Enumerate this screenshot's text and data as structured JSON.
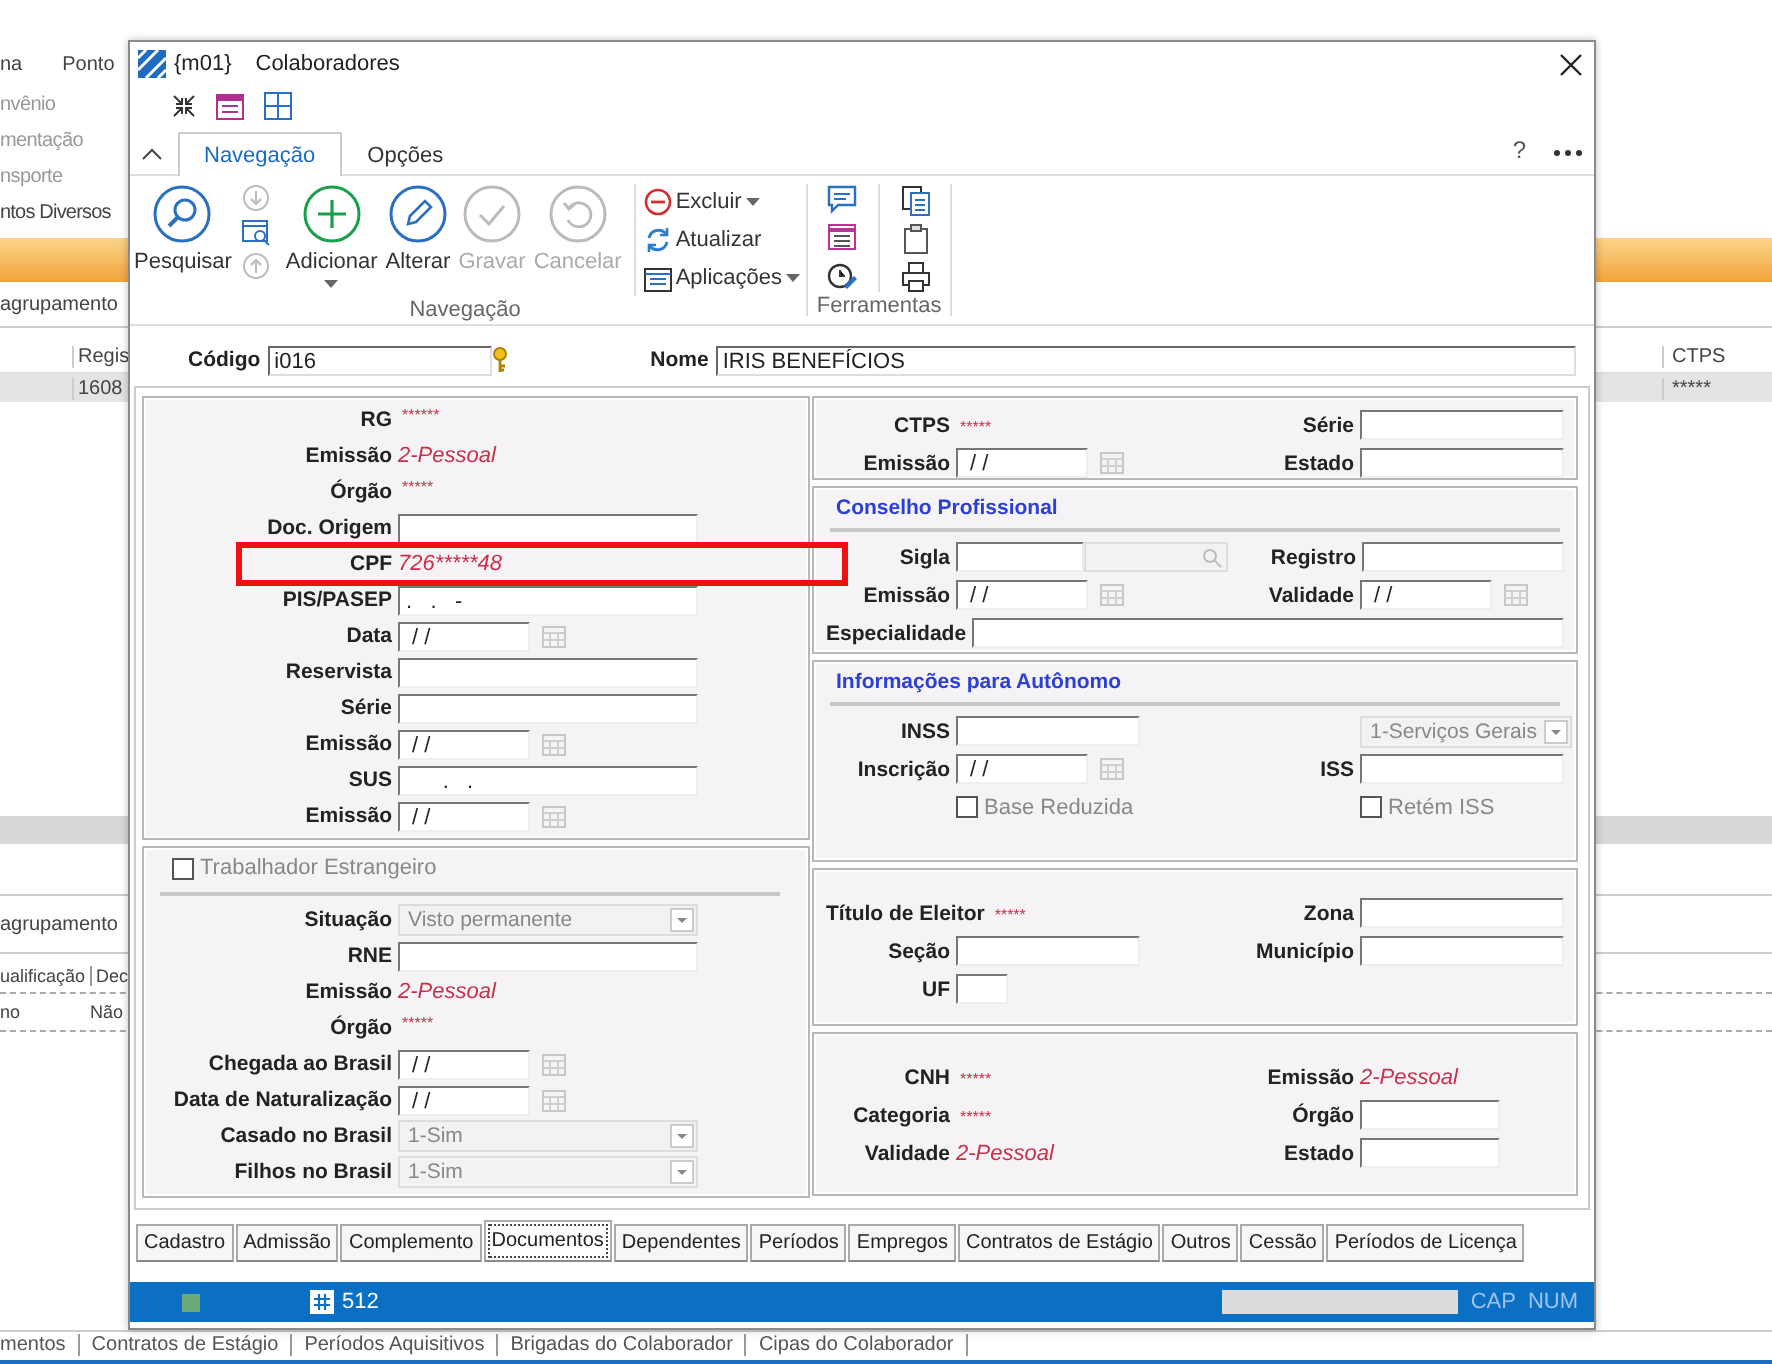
{
  "background": {
    "menu": [
      "na",
      "Ponto"
    ],
    "side_items": [
      "nvênio",
      "mentação",
      "nsporte"
    ],
    "section": "ntos Diversos",
    "group_bar": "agrupamento",
    "columns": [
      "Regis",
      "CTPS"
    ],
    "row": [
      "1608",
      "*****"
    ],
    "group_bar_2": "agrupamento",
    "columns_2": [
      "ualificação",
      "Dec"
    ],
    "row_2": [
      "no",
      "Não"
    ],
    "bottom_tabs": [
      "mentos",
      "Contratos de Estágio",
      "Períodos Aquisitivos",
      "Brigadas do Colaborador",
      "Cipas do Colaborador"
    ]
  },
  "window": {
    "code": "{m01}",
    "title": "Colaboradores"
  },
  "ribbon": {
    "tabs": [
      {
        "label": "Navegação",
        "selected": true
      },
      {
        "label": "Opções",
        "selected": false
      }
    ],
    "help": "?",
    "groups": [
      {
        "label": "Navegação",
        "large_buttons": [
          {
            "label": "Pesquisar",
            "disabled": false,
            "has_menu": false
          },
          {
            "label": "Adicionar",
            "disabled": false,
            "has_menu": true
          },
          {
            "label": "Alterar",
            "disabled": false,
            "has_menu": false
          },
          {
            "label": "Gravar",
            "disabled": true,
            "has_menu": false
          },
          {
            "label": "Cancelar",
            "disabled": true,
            "has_menu": false
          }
        ],
        "small_buttons": [
          {
            "label": "Excluir",
            "has_menu": true
          },
          {
            "label": "Atualizar",
            "has_menu": false
          },
          {
            "label": "Aplicações",
            "has_menu": true
          }
        ]
      },
      {
        "label": "Ferramentas"
      }
    ]
  },
  "header": {
    "code": {
      "label": "Código",
      "value": "i016"
    },
    "name": {
      "label": "Nome",
      "value": "IRIS BENEFÍCIOS"
    }
  },
  "left_panels": [
    {
      "rows": [
        {
          "label": "RG",
          "kind": "masked",
          "value": "******"
        },
        {
          "label": "Emissão",
          "kind": "text",
          "value": "2-Pessoal"
        },
        {
          "label": "Órgão",
          "kind": "masked",
          "value": "*****"
        },
        {
          "label": "Doc. Origem",
          "kind": "field"
        },
        {
          "label": "CPF",
          "kind": "text",
          "value": "726*****48"
        },
        {
          "label": "PIS/PASEP",
          "kind": "field",
          "value": ".   .   -"
        },
        {
          "label": "Data",
          "kind": "date",
          "value": "/ /"
        },
        {
          "label": "Reservista",
          "kind": "field"
        },
        {
          "label": "Série",
          "kind": "field"
        },
        {
          "label": "Emissão",
          "kind": "date",
          "value": "/ /"
        },
        {
          "label": "SUS",
          "kind": "field",
          "value": "      .   ."
        },
        {
          "label": "Emissão",
          "kind": "date",
          "value": "/ /"
        }
      ]
    },
    {
      "header_checkbox": {
        "label": "Trabalhador Estrangeiro",
        "checked": false,
        "disabled": true
      },
      "rows": [
        {
          "label": "Situação",
          "kind": "select",
          "value": "Visto permanente",
          "disabled": true
        },
        {
          "label": "RNE",
          "kind": "field"
        },
        {
          "label": "Emissão",
          "kind": "text",
          "value": "2-Pessoal"
        },
        {
          "label": "Órgão",
          "kind": "masked",
          "value": "*****"
        },
        {
          "label": "Chegada ao Brasil",
          "kind": "date",
          "value": "/ /"
        },
        {
          "label": "Data de Naturalização",
          "kind": "date",
          "value": "/ /"
        },
        {
          "label": "Casado no Brasil",
          "kind": "select",
          "value": "1-Sim",
          "disabled": true
        },
        {
          "label": "Filhos no Brasil",
          "kind": "select",
          "value": "1-Sim",
          "disabled": true
        }
      ]
    }
  ],
  "right_panels": [
    {
      "rows": [
        [
          {
            "label": "CTPS",
            "kind": "masked",
            "value": "*****"
          },
          {
            "label": "Série",
            "kind": "field"
          }
        ],
        [
          {
            "label": "Emissão",
            "kind": "date",
            "value": "/ /"
          },
          {
            "label": "Estado",
            "kind": "field"
          }
        ]
      ]
    },
    {
      "title": "Conselho Profissional",
      "rows": [
        [
          {
            "label": "Sigla",
            "kind": "lookup"
          },
          {
            "label": "Registro",
            "kind": "field"
          }
        ],
        [
          {
            "label": "Emissão",
            "kind": "date",
            "value": "/ /"
          },
          {
            "label": "Validade",
            "kind": "date",
            "value": "/ /"
          }
        ],
        [
          {
            "label": "Especialidade",
            "kind": "field"
          }
        ]
      ]
    },
    {
      "title": "Informações para Autônomo",
      "rows": [
        [
          {
            "label": "INSS",
            "kind": "field"
          },
          {
            "kind": "select",
            "value": "1-Serviços Gerais",
            "disabled": true
          }
        ],
        [
          {
            "label": "Inscrição",
            "kind": "date",
            "value": "/ /"
          },
          {
            "label": "ISS",
            "kind": "field"
          }
        ],
        [
          {
            "kind": "checkbox",
            "label": "Base Reduzida",
            "checked": false,
            "disabled": true
          },
          {
            "kind": "checkbox",
            "label": "Retém ISS",
            "checked": false,
            "disabled": true
          }
        ]
      ]
    },
    {
      "rows": [
        [
          {
            "label": "Título de Eleitor",
            "kind": "masked",
            "value": "*****"
          },
          {
            "label": "Zona",
            "kind": "field"
          }
        ],
        [
          {
            "label": "Seção",
            "kind": "field"
          },
          {
            "label": "Município",
            "kind": "field"
          }
        ],
        [
          {
            "label": "UF",
            "kind": "small_field"
          }
        ]
      ]
    },
    {
      "rows": [
        [
          {
            "label": "CNH",
            "kind": "masked",
            "value": "*****"
          },
          {
            "label": "Emissão",
            "kind": "text",
            "value": "2-Pessoal"
          }
        ],
        [
          {
            "label": "Categoria",
            "kind": "masked",
            "value": "*****"
          },
          {
            "label": "Órgão",
            "kind": "short_field"
          }
        ],
        [
          {
            "label": "Validade",
            "kind": "text",
            "value": "2-Pessoal"
          },
          {
            "label": "Estado",
            "kind": "short_field"
          }
        ]
      ]
    }
  ],
  "tabs": [
    {
      "label": "Cadastro",
      "selected": false
    },
    {
      "label": "Admissão",
      "selected": false
    },
    {
      "label": "Complemento",
      "selected": false
    },
    {
      "label": "Documentos",
      "selected": true
    },
    {
      "label": "Dependentes",
      "selected": false
    },
    {
      "label": "Períodos",
      "selected": false
    },
    {
      "label": "Empregos",
      "selected": false
    },
    {
      "label": "Contratos de Estágio",
      "selected": false
    },
    {
      "label": "Outros",
      "selected": false
    },
    {
      "label": "Cessão",
      "selected": false
    },
    {
      "label": "Períodos de Licença",
      "selected": false
    }
  ],
  "status_bar": {
    "record": "512",
    "indicators": [
      "CAP",
      "NUM"
    ]
  }
}
